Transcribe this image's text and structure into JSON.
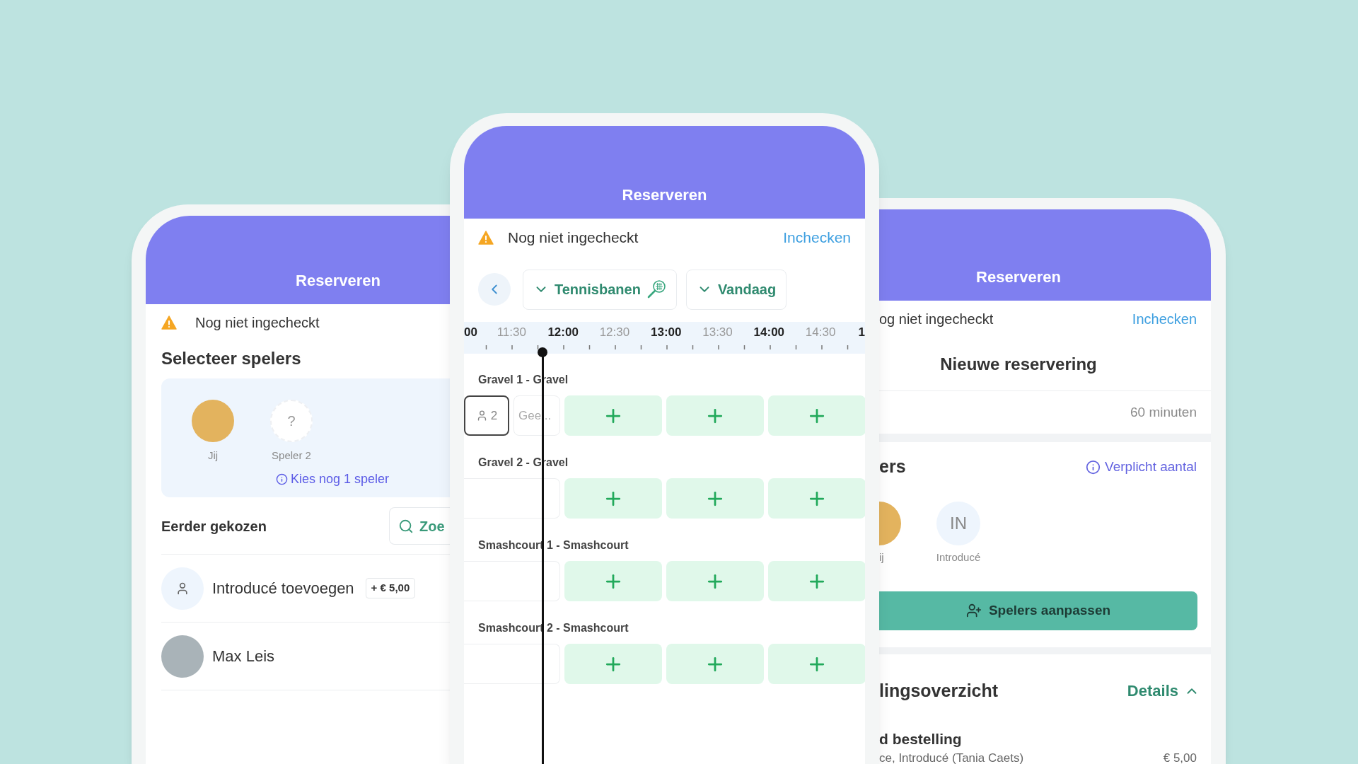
{
  "left_screen": {
    "header_title": "Reserveren",
    "checkin_status": "Nog niet ingecheckt",
    "section_title": "Selecteer spelers",
    "players": [
      {
        "name": "Jij",
        "kind": "photo"
      },
      {
        "name": "Speler 2",
        "kind": "empty",
        "placeholder_mark": "?"
      }
    ],
    "hint": "Kies nog 1 speler",
    "previous_title": "Eerder gekozen",
    "search_button": "Zoe",
    "contacts": [
      {
        "name": "Introducé toevoegen",
        "kind": "add",
        "price": "+ € 5,00"
      },
      {
        "name": "Max Leis",
        "kind": "photo"
      }
    ]
  },
  "center_screen": {
    "header_title": "Reserveren",
    "checkin_status": "Nog niet ingecheckt",
    "checkin_link": "Inchecken",
    "filters": [
      {
        "label": "Tennisbanen",
        "kind": "courts"
      },
      {
        "label": "Vandaag",
        "kind": "date"
      }
    ],
    "timeline": [
      {
        "label": "00",
        "kind": "hour"
      },
      {
        "label": "11:30",
        "kind": "half"
      },
      {
        "label": "12:00",
        "kind": "hour"
      },
      {
        "label": "12:30",
        "kind": "half"
      },
      {
        "label": "13:00",
        "kind": "hour"
      },
      {
        "label": "13:30",
        "kind": "half"
      },
      {
        "label": "14:00",
        "kind": "hour"
      },
      {
        "label": "14:30",
        "kind": "half"
      },
      {
        "label": "1",
        "kind": "hour"
      }
    ],
    "courts": [
      {
        "name": "Gravel 1 - Gravel",
        "slots": [
          {
            "kind": "players",
            "text": "2"
          },
          {
            "kind": "note",
            "text": "Gee..."
          },
          {
            "kind": "free"
          },
          {
            "kind": "free"
          },
          {
            "kind": "free"
          }
        ]
      },
      {
        "name": "Gravel 2 - Gravel",
        "slots": [
          {
            "kind": "past"
          },
          {
            "kind": "free"
          },
          {
            "kind": "free"
          },
          {
            "kind": "free"
          }
        ]
      },
      {
        "name": "Smashcourt 1 - Smashcourt",
        "slots": [
          {
            "kind": "past"
          },
          {
            "kind": "free"
          },
          {
            "kind": "free"
          },
          {
            "kind": "free"
          }
        ]
      },
      {
        "name": "Smashcourt 2 - Smashcourt",
        "slots": [
          {
            "kind": "past"
          },
          {
            "kind": "free"
          },
          {
            "kind": "free"
          },
          {
            "kind": "free"
          }
        ]
      }
    ]
  },
  "right_screen": {
    "header_title": "Reserveren",
    "checkin_status": "og niet ingecheckt",
    "checkin_link": "Inchecken",
    "title": "Nieuwe reservering",
    "duration": "60 minuten",
    "players_title": "ers",
    "players_hint": "Verplicht aantal",
    "players": [
      {
        "name": "ij",
        "kind": "photo"
      },
      {
        "name": "Introducé",
        "kind": "initials",
        "initials": "IN"
      }
    ],
    "edit_button": "Spelers aanpassen",
    "summary_title": "lingsoverzicht",
    "details_link": "Details",
    "details_expanded": true,
    "order_title": "d bestelling",
    "order_lines": [
      {
        "text": "ce, Introducé (Tania Caets)",
        "price": "€ 5,00"
      }
    ]
  }
}
